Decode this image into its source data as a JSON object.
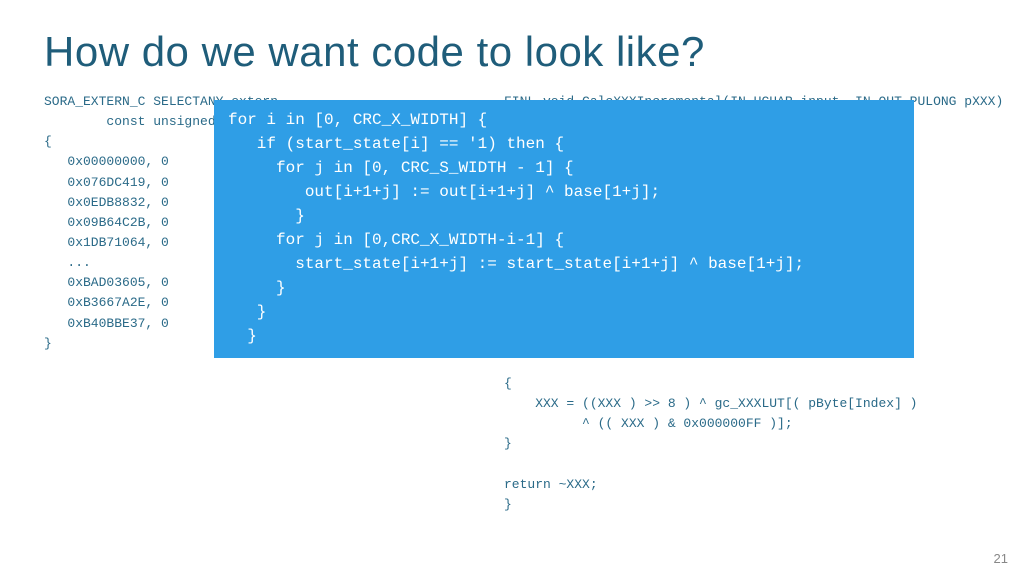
{
  "title": "How do we want code to look like?",
  "left_code": "SORA_EXTERN_C SELECTANY extern\n        const unsigned\n{\n   0x00000000, 0\n   0x076DC419, 0\n   0x0EDB8832, 0\n   0x09B64C2B, 0\n   0x1DB71064, 0\n   ...\n   0xBAD03605, 0\n   0xB3667A2E, 0\n   0xB40BBE37, 0\n}",
  "right_code": "FINL void CalcXXXIncremental(IN UCHAR input, IN OUT PULONG pXXX)\n\n\n\n\n\n\n\n\n\n\n\n\n\n{\n    XXX = ((XXX ) >> 8 ) ^ gc_XXXLUT[( pByte[Index] )\n          ^ (( XXX ) & 0x000000FF )];\n}\n\nreturn ~XXX;\n}",
  "overlay_code": "for i in [0, CRC_X_WIDTH] {\n   if (start_state[i] == '1) then {\n     for j in [0, CRC_S_WIDTH - 1] {\n        out[i+1+j] := out[i+1+j] ^ base[1+j];\n       }\n     for j in [0,CRC_X_WIDTH-i-1] {\n       start_state[i+1+j] := start_state[i+1+j] ^ base[1+j];\n     }\n   }\n  }",
  "page_number": "21"
}
